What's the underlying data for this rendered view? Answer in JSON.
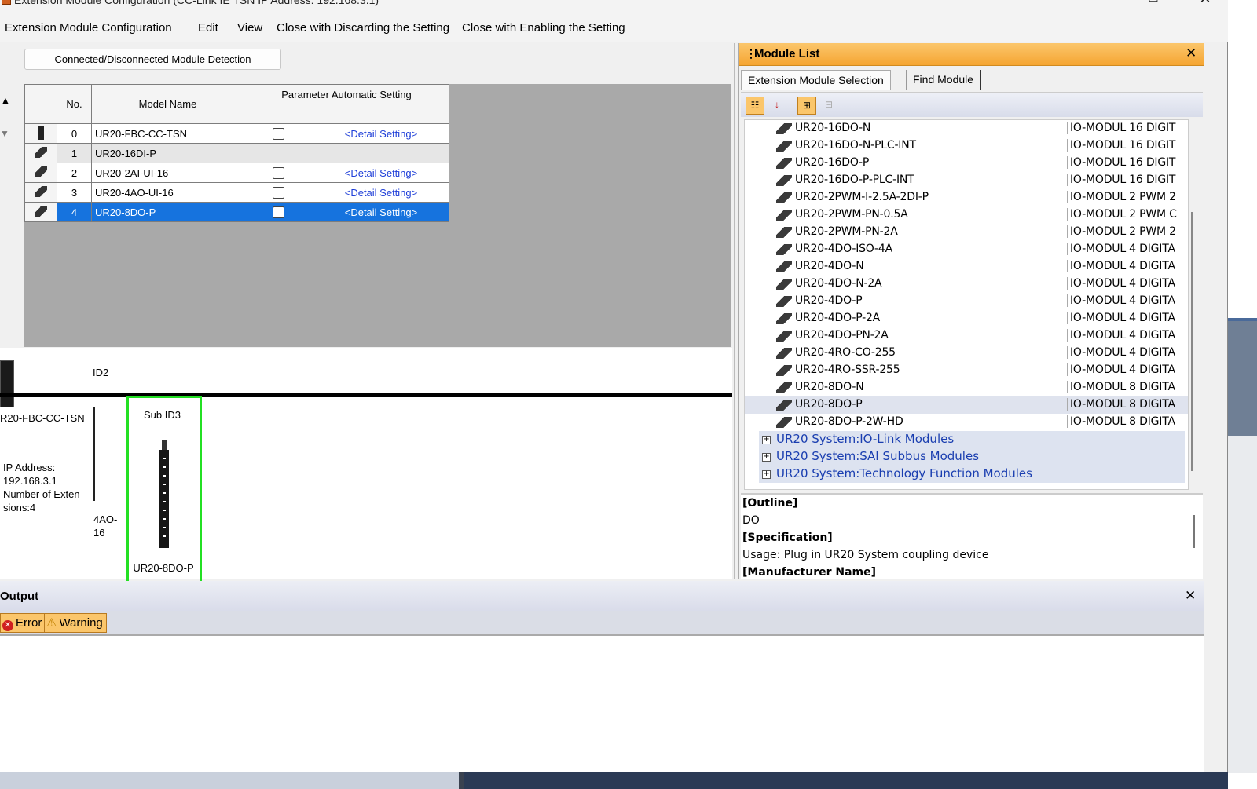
{
  "window": {
    "title": "Extension Module Configuration (CC-Link IE TSN IP Address: 192.168.3.1)",
    "maximize_icon": "maximize-icon",
    "close_icon": "close-icon"
  },
  "menu": {
    "items": [
      "Extension Module Configuration",
      "Edit",
      "View",
      "Close with Discarding the Setting",
      "Close with Enabling the Setting"
    ]
  },
  "config": {
    "detect_button": "Connected/Disconnected Module Detection",
    "headers": {
      "no": "No.",
      "model_name": "Model Name",
      "param_auto": "Parameter Automatic Setting"
    },
    "rows": [
      {
        "no": "0",
        "model": "UR20-FBC-CC-TSN",
        "checked": false,
        "has_check": true,
        "detail": "<Detail Setting>"
      },
      {
        "no": "1",
        "model": "UR20-16DI-P",
        "checked": false,
        "has_check": false,
        "detail": ""
      },
      {
        "no": "2",
        "model": "UR20-2AI-UI-16",
        "checked": false,
        "has_check": true,
        "detail": "<Detail Setting>"
      },
      {
        "no": "3",
        "model": "UR20-4AO-UI-16",
        "checked": false,
        "has_check": true,
        "detail": "<Detail Setting>"
      },
      {
        "no": "4",
        "model": "UR20-8DO-P",
        "checked": false,
        "has_check": true,
        "detail": "<Detail Setting>",
        "selected": true
      }
    ]
  },
  "diagram": {
    "coupler_label": "R20-FBC-CC-TSN",
    "ip_label": "IP Address:",
    "ip_value": "192.168.3.1",
    "ext_label": "Number of Exten sions:4",
    "id2": "ID2",
    "prev_label_1": "4AO-",
    "prev_label_2": "16",
    "subid3": "Sub ID3",
    "dev_label": "UR20-8DO-P"
  },
  "module_list": {
    "title": "Module List",
    "tabs": [
      "Extension Module Selection",
      "Find Module"
    ],
    "items": [
      {
        "name": "UR20-16DO-N",
        "desc": "IO-MODUL 16 DIGIT"
      },
      {
        "name": "UR20-16DO-N-PLC-INT",
        "desc": "IO-MODUL 16 DIGIT"
      },
      {
        "name": "UR20-16DO-P",
        "desc": "IO-MODUL 16 DIGIT"
      },
      {
        "name": "UR20-16DO-P-PLC-INT",
        "desc": "IO-MODUL 16 DIGIT"
      },
      {
        "name": "UR20-2PWM-I-2.5A-2DI-P",
        "desc": "IO-MODUL 2 PWM 2"
      },
      {
        "name": "UR20-2PWM-PN-0.5A",
        "desc": "IO-MODUL 2 PWM C"
      },
      {
        "name": "UR20-2PWM-PN-2A",
        "desc": "IO-MODUL 2 PWM 2"
      },
      {
        "name": "UR20-4DO-ISO-4A",
        "desc": "IO-MODUL 4 DIGITA"
      },
      {
        "name": "UR20-4DO-N",
        "desc": "IO-MODUL 4 DIGITA"
      },
      {
        "name": "UR20-4DO-N-2A",
        "desc": "IO-MODUL 4 DIGITA"
      },
      {
        "name": "UR20-4DO-P",
        "desc": "IO-MODUL 4 DIGITA"
      },
      {
        "name": "UR20-4DO-P-2A",
        "desc": "IO-MODUL 4 DIGITA"
      },
      {
        "name": "UR20-4DO-PN-2A",
        "desc": "IO-MODUL 4 DIGITA"
      },
      {
        "name": "UR20-4RO-CO-255",
        "desc": "IO-MODUL 4 DIGITA"
      },
      {
        "name": "UR20-4RO-SSR-255",
        "desc": "IO-MODUL 4 DIGITA"
      },
      {
        "name": "UR20-8DO-N",
        "desc": "IO-MODUL 8 DIGITA"
      },
      {
        "name": "UR20-8DO-P",
        "desc": "IO-MODUL 8 DIGITA",
        "highlighted": true
      },
      {
        "name": "UR20-8DO-P-2W-HD",
        "desc": "IO-MODUL 8 DIGITA"
      }
    ],
    "groups": [
      "UR20 System:IO-Link Modules",
      "UR20 System:SAI Subbus Modules",
      "UR20 System:Technology Function Modules"
    ],
    "outline": {
      "outline_title": "[Outline]",
      "outline_value": "DO",
      "spec_title": "[Specification]",
      "spec_value": "Usage: Plug in UR20 System coupling device",
      "mfr_title": "[Manufacturer Name]"
    }
  },
  "output": {
    "title": "Output",
    "error_label": "Error",
    "warning_label": "Warning"
  }
}
